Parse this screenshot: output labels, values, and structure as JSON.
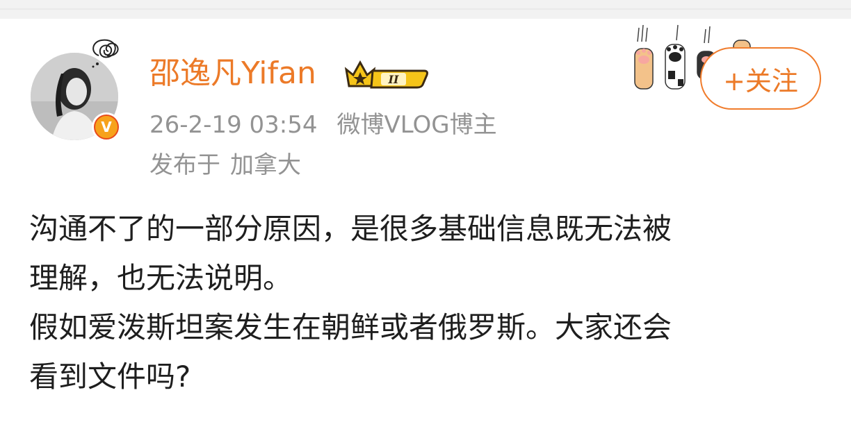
{
  "user": {
    "name": "邵逸凡Yifan",
    "vip_level": "II",
    "verified_mark": "V"
  },
  "post": {
    "date": "26-2-19 03:54",
    "source": "微博VLOG博主",
    "location_prefix": "发布于",
    "location": "加拿大",
    "lines": [
      "沟通不了的一部分原因，是很多基础信息既无法被",
      "理解，也无法说明。",
      "假如爱泼斯坦案发生在朝鲜或者俄罗斯。大家还会",
      "看到文件吗?"
    ]
  },
  "actions": {
    "follow_label": "+关注"
  },
  "icons": {
    "avatar": "user-avatar",
    "verified": "verified-v-icon",
    "crown": "vip-crown-icon",
    "paws": "cat-paw-decoration-icon",
    "scribble": "scribble-thought-icon"
  },
  "colors": {
    "accent": "#ec7a28",
    "meta_text": "#939393",
    "body_text": "#1e1e1e"
  }
}
